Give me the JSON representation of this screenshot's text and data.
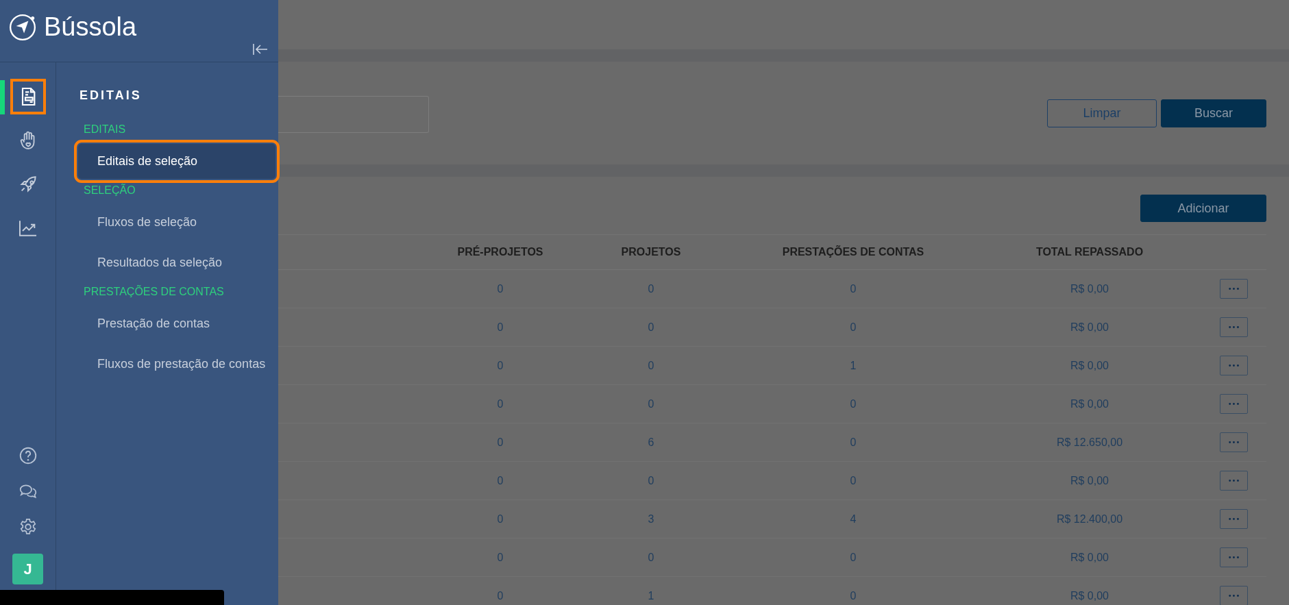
{
  "sidebar": {
    "logo": "Bússola",
    "rail": [
      {
        "kind": "document",
        "selected": true,
        "highlighted": true
      },
      {
        "kind": "hand",
        "selected": false,
        "highlighted": false
      },
      {
        "kind": "rocket",
        "selected": false,
        "highlighted": false
      },
      {
        "kind": "chart",
        "selected": false,
        "highlighted": false
      }
    ],
    "rail_bottom": [
      {
        "kind": "help"
      },
      {
        "kind": "chat"
      },
      {
        "kind": "settings"
      }
    ],
    "avatar": "J",
    "menu_title": "EDITAIS",
    "sections": [
      {
        "heading": "EDITAIS",
        "items": [
          {
            "label": "Editais de seleção",
            "selected": true,
            "highlighted": true
          }
        ]
      },
      {
        "heading": "SELEÇÃO",
        "items": [
          {
            "label": "Fluxos de seleção",
            "selected": false,
            "highlighted": false
          },
          {
            "label": "Resultados da seleção",
            "selected": false,
            "highlighted": false
          }
        ]
      },
      {
        "heading": "PRESTAÇÕES DE CONTAS",
        "items": [
          {
            "label": "Prestação de contas",
            "selected": false,
            "highlighted": false
          },
          {
            "label": "Fluxos de prestação de contas",
            "selected": false,
            "highlighted": false
          }
        ]
      }
    ]
  },
  "filters": {
    "buttons": [
      {
        "label": "Limpar",
        "kind": "outline"
      },
      {
        "label": "Buscar",
        "kind": "primary"
      }
    ]
  },
  "table": {
    "add_button": "Adicionar",
    "columns": [
      "PRÉ-PROJETOS",
      "PROJETOS",
      "PRESTAÇÕES DE CONTAS",
      "TOTAL REPASSADO"
    ],
    "rows": [
      {
        "cells": [
          "0",
          "0",
          "0",
          "R$ 0,00"
        ],
        "action": "•••"
      },
      {
        "cells": [
          "0",
          "0",
          "0",
          "R$ 0,00"
        ],
        "action": "•••"
      },
      {
        "cells": [
          "0",
          "0",
          "1",
          "R$ 0,00"
        ],
        "action": "•••"
      },
      {
        "cells": [
          "0",
          "0",
          "0",
          "R$ 0,00"
        ],
        "action": "•••"
      },
      {
        "cells": [
          "0",
          "6",
          "0",
          "R$ 12.650,00"
        ],
        "action": "•••"
      },
      {
        "cells": [
          "0",
          "0",
          "0",
          "R$ 0,00"
        ],
        "action": "•••"
      },
      {
        "cells": [
          "0",
          "3",
          "4",
          "R$ 12.400,00"
        ],
        "action": "•••"
      },
      {
        "cells": [
          "0",
          "0",
          "0",
          "R$ 0,00"
        ],
        "action": "•••"
      },
      {
        "cells": [
          "0",
          "1",
          "0",
          "R$ 0,00"
        ],
        "action": "•••"
      }
    ]
  }
}
